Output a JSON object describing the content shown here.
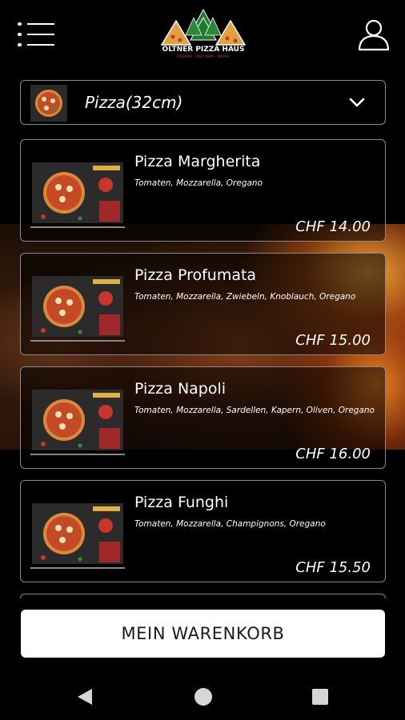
{
  "header": {
    "logo_icon": "oltner-pizza-haus-logo",
    "logo_title": "OLTNER PIZZA HAUS",
    "logo_tagline": "PIZZERIA · TAKE AWAY · KURIER",
    "menu_icon": "hamburger-menu-icon",
    "user_icon": "user-account-icon"
  },
  "category": {
    "selected": "Pizza(32cm)",
    "icon": "chevron-down-icon"
  },
  "items": [
    {
      "name": "Pizza Margherita",
      "description": "Tomaten, Mozzarella, Oregano",
      "price": "CHF 14.00"
    },
    {
      "name": "Pizza Profumata",
      "description": "Tomaten, Mozzarella, Zwiebeln, Knoblauch, Oregano",
      "price": "CHF 15.00"
    },
    {
      "name": "Pizza Napoli",
      "description": "Tomaten, Mozzarella, Sardellen, Kapern, Oliven, Oregano",
      "price": "CHF 16.00"
    },
    {
      "name": "Pizza Funghi",
      "description": "Tomaten, Mozzarella, Champignons, Oregano",
      "price": "CHF 15.50"
    }
  ],
  "cart": {
    "label": "MEIN WARENKORB"
  },
  "colors": {
    "background": "#000000",
    "card_border": "#8a8a8a",
    "cart_button": "#ffffff",
    "logo_green": "#1f7a2e",
    "logo_red": "#c8352a"
  }
}
